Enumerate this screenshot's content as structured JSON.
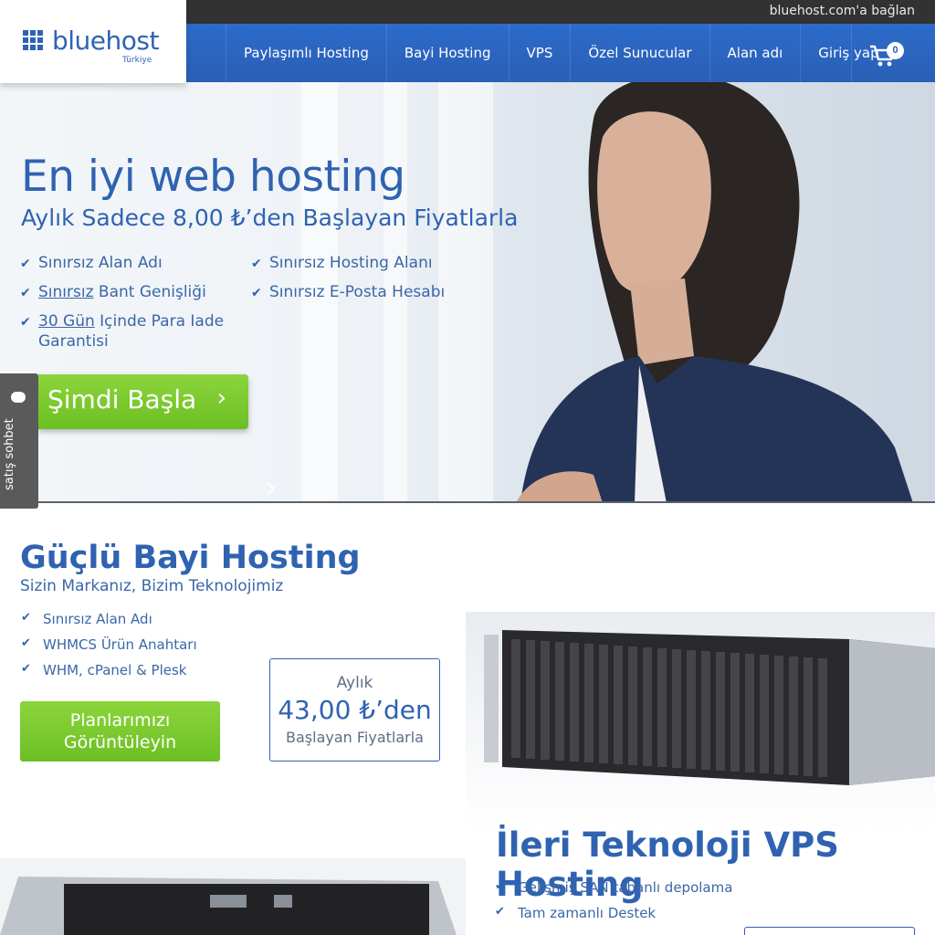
{
  "topbar": {
    "connect": "bluehost.com'a bağlan"
  },
  "logo": {
    "name": "bluehost",
    "sub": "Türkiye"
  },
  "nav": {
    "items": [
      "Paylaşımlı Hosting",
      "Bayi Hosting",
      "VPS",
      "Özel Sunucular",
      "Alan adı",
      "Giriş yap"
    ],
    "cart_count": "0"
  },
  "hero": {
    "title": "En iyi web hosting",
    "subtitle": "Aylık Sadece 8,00 ₺’den Başlayan Fiyatlarla",
    "features": {
      "f1": "Sınırsız Alan Adı",
      "f2_link": "Sınırsız",
      "f2_rest": " Bant Genişliği",
      "f3_link": "30 Gün",
      "f3_rest": " Içinde Para Iade",
      "f3_line2": "Garantisi",
      "f4": "Sınırsız Hosting Alanı",
      "f5": "Sınırsız E-Posta Hesabı"
    },
    "cta": "Şimdi Başla",
    "cta_arrow": "›",
    "ghost_arrow": "›"
  },
  "chat": {
    "label": "satış sohbet"
  },
  "reseller": {
    "title": "Güçlü Bayi Hosting",
    "subtitle": "Sizin Markanız, Bizim Teknolojimiz",
    "features": [
      "Sınırsız Alan Adı",
      "WHMCS Ürün Anahtarı",
      "WHM, cPanel & Plesk"
    ],
    "button_line1": "Planlarımızı",
    "button_line2": "Görüntüleyin",
    "price": {
      "label": "Aylık",
      "amount": "43,00 ₺’den",
      "caption": "Başlayan Fiyatlarla"
    }
  },
  "vps": {
    "title": "İleri Teknoloji VPS Hosting",
    "features": [
      "Gelişmiş SAN tabanlı depolama",
      "Tam zamanlı Destek"
    ]
  },
  "icons": {
    "check": "check-icon",
    "cart": "cart-icon",
    "chat": "chat-bubble-icon",
    "logo_grid": "logo-grid-icon"
  },
  "colors": {
    "brand_blue": "#2f63b1",
    "nav_blue": "#2a5fb6",
    "green": "#7ac930",
    "topbar": "#323232"
  }
}
